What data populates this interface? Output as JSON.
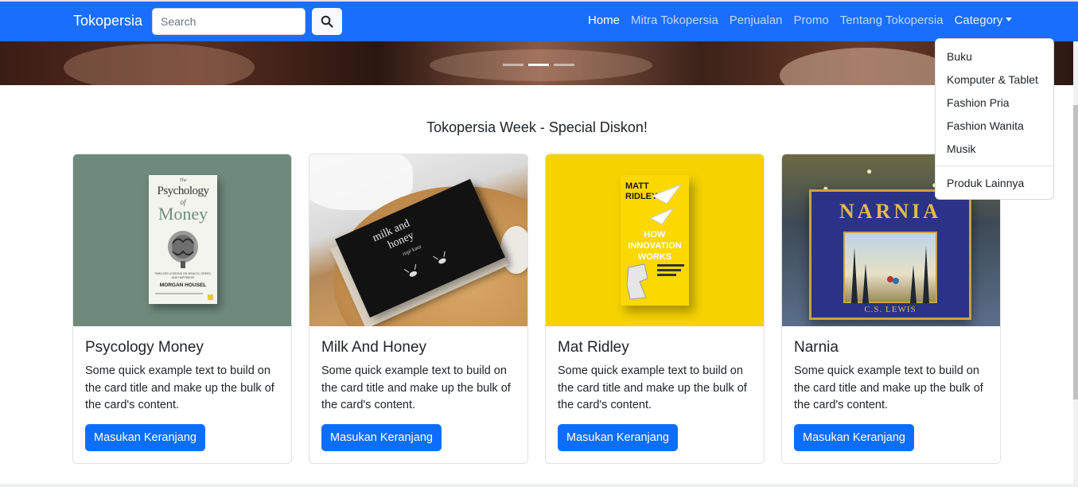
{
  "navbar": {
    "brand": "Tokopersia",
    "search_placeholder": "Search",
    "links": [
      "Home",
      "Mitra Tokopersia",
      "Penjualan",
      "Promo",
      "Tentang Tokopersia"
    ],
    "dropdown_label": "Category"
  },
  "category_menu": {
    "items": [
      "Buku",
      "Komputer & Tablet",
      "Fashion Pria",
      "Fashion Wanita",
      "Musik"
    ],
    "extra": "Produk Lainnya"
  },
  "section_title": "Tokopersia Week - Special Diskon!",
  "cards": [
    {
      "title": "Psycology Money",
      "text": "Some quick example text to build on the card title and make up the bulk of the card's content.",
      "button": "Masukan Keranjang"
    },
    {
      "title": "Milk And Honey",
      "text": "Some quick example text to build on the card title and make up the bulk of the card's content.",
      "button": "Masukan Keranjang"
    },
    {
      "title": "Mat Ridley",
      "text": "Some quick example text to build on the card title and make up the bulk of the card's content.",
      "button": "Masukan Keranjang"
    },
    {
      "title": "Narnia",
      "text": "Some quick example text to build on the card title and make up the bulk of the card's content.",
      "button": "Masukan Keranjang"
    }
  ],
  "book_covers": {
    "psychology": {
      "line1": "The",
      "line2": "Psychology",
      "line3": "of",
      "line4": "Money",
      "subtitle": "TIMELESS LESSONS ON WEALTH, GREED, AND HAPPINESS",
      "author": "MORGAN HOUSEL"
    },
    "milk": {
      "line1": "milk and",
      "line2": "honey",
      "author": "rupi kaur"
    },
    "ridley": {
      "author1": "MATT",
      "author2": "RIDLEY",
      "title1": "HOW",
      "title2": "INNOVATION",
      "title3": "WORKS"
    },
    "narnia": {
      "title": "NARNIA",
      "author": "C.S. LEWIS"
    }
  },
  "colors": {
    "navbar": "#1a6efd",
    "button": "#0d6efd",
    "icon_search": "search-icon"
  },
  "carousel": {
    "slides": 3,
    "active": 1
  }
}
